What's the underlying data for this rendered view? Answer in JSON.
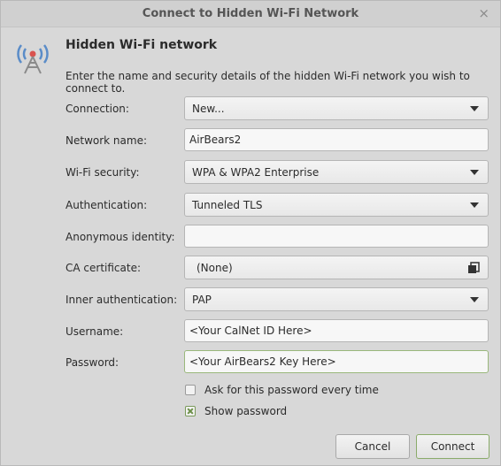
{
  "window": {
    "title": "Connect to Hidden Wi-Fi Network",
    "close_glyph": "×"
  },
  "header": {
    "icon": "wifi-tower-icon",
    "title": "Hidden Wi-Fi network",
    "description": "Enter the name and security details of the hidden Wi-Fi network you wish to connect to."
  },
  "form": {
    "connection": {
      "label": "Connection:",
      "value": "New..."
    },
    "network_name": {
      "label": "Network name:",
      "value": "AirBears2"
    },
    "wifi_security": {
      "label": "Wi-Fi security:",
      "value": "WPA & WPA2 Enterprise"
    },
    "authentication": {
      "label": "Authentication:",
      "value": "Tunneled TLS"
    },
    "anonymous_identity": {
      "label": "Anonymous identity:",
      "value": ""
    },
    "ca_certificate": {
      "label": "CA certificate:",
      "value": "(None)"
    },
    "inner_authentication": {
      "label": "Inner authentication:",
      "value": "PAP"
    },
    "username": {
      "label": "Username:",
      "value": "<Your CalNet ID Here>"
    },
    "password": {
      "label": "Password:",
      "value": "<Your AirBears2 Key Here>"
    },
    "ask_password": {
      "label": "Ask for this password every time",
      "checked": false
    },
    "show_password": {
      "label": "Show password",
      "checked": true
    }
  },
  "buttons": {
    "cancel": "Cancel",
    "connect": "Connect"
  },
  "colors": {
    "accent": "#8aab6a",
    "background": "#d8d8d8"
  }
}
